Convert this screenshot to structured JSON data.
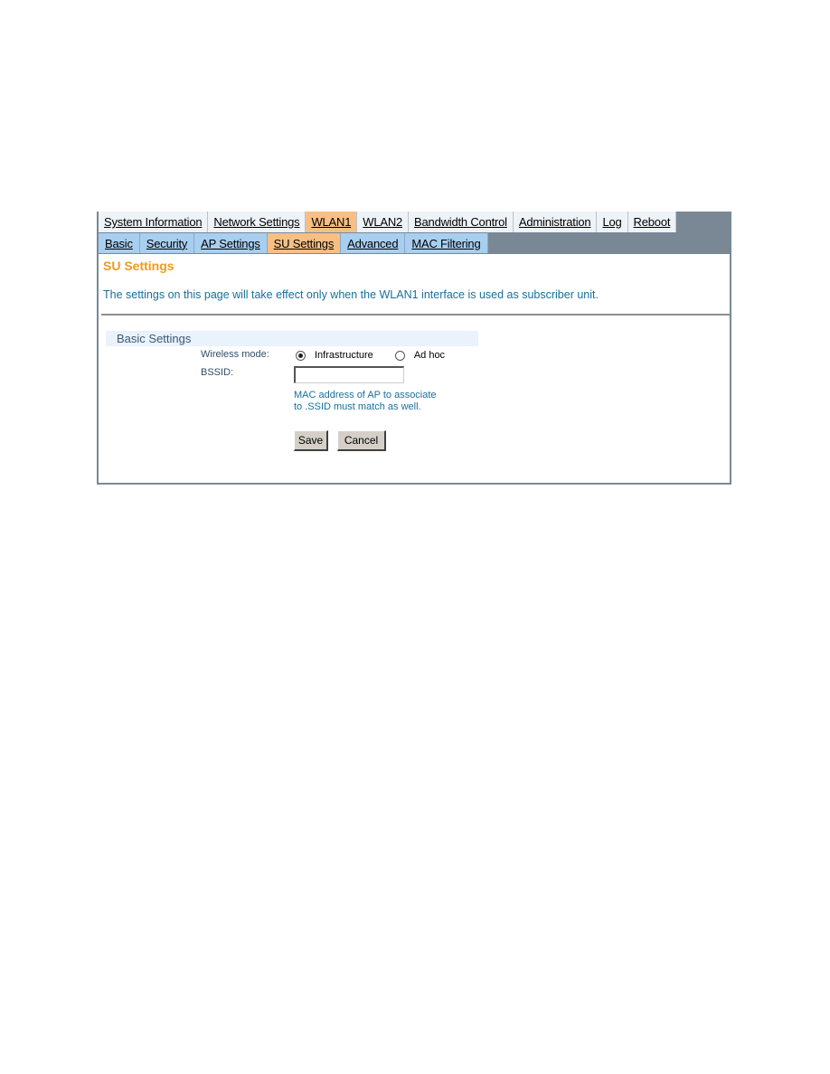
{
  "main_tabs": [
    {
      "label": "System Information",
      "active": false
    },
    {
      "label": "Network Settings",
      "active": false
    },
    {
      "label": "WLAN1",
      "active": true
    },
    {
      "label": "WLAN2",
      "active": false
    },
    {
      "label": "Bandwidth Control",
      "active": false
    },
    {
      "label": "Administration",
      "active": false
    },
    {
      "label": "Log",
      "active": false
    },
    {
      "label": "Reboot",
      "active": false
    }
  ],
  "sub_tabs": [
    {
      "label": "Basic",
      "active": false
    },
    {
      "label": "Security",
      "active": false
    },
    {
      "label": "AP Settings",
      "active": false
    },
    {
      "label": "SU Settings",
      "active": true
    },
    {
      "label": "Advanced",
      "active": false
    },
    {
      "label": "MAC Filtering",
      "active": false
    }
  ],
  "page": {
    "title": "SU Settings",
    "note": "The settings on this page will take effect only when the WLAN1 interface is used as subscriber unit."
  },
  "basic_settings": {
    "header": "Basic Settings",
    "wireless_mode": {
      "label": "Wireless mode:",
      "options": [
        {
          "label": "Infrastructure",
          "checked": true
        },
        {
          "label": "Ad hoc",
          "checked": false
        }
      ]
    },
    "bssid": {
      "label": "BSSID:",
      "value": "",
      "hint_line1": "MAC address of AP to associate",
      "hint_line2": "to .SSID must match as well."
    }
  },
  "buttons": {
    "save": "Save",
    "cancel": "Cancel"
  },
  "colors": {
    "active_tab": "#f8bf84",
    "main_tab": "#eef3f8",
    "sub_tab": "#a8cff0",
    "tabbar_bg": "#7a8896",
    "title": "#f29a1f",
    "note_text": "#1a6f9a"
  }
}
